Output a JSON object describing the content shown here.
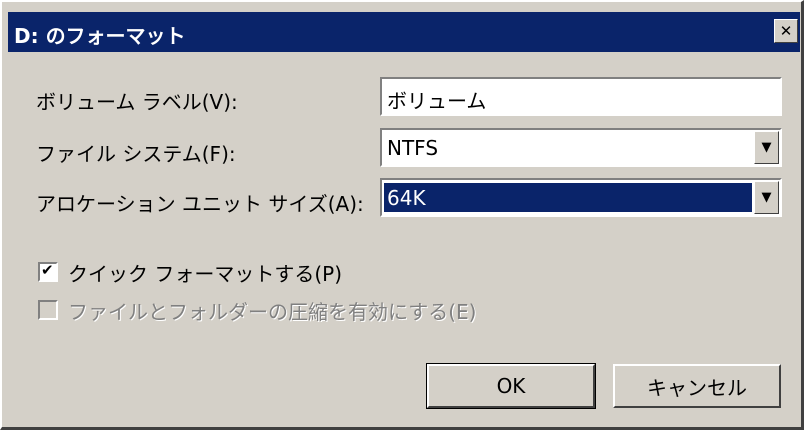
{
  "window": {
    "title": "D: のフォーマット",
    "close_label": "✕"
  },
  "form": {
    "volume_label": {
      "label": "ボリューム ラベル(V):",
      "value": "ボリューム"
    },
    "file_system": {
      "label": "ファイル システム(F):",
      "value": "NTFS"
    },
    "allocation_unit": {
      "label": "アロケーション ユニット サイズ(A):",
      "value": "64K"
    }
  },
  "options": {
    "quick_format": {
      "label": "クイック フォーマットする(P)",
      "checked": true,
      "check_glyph": "✔"
    },
    "compression": {
      "label": "ファイルとフォルダーの圧縮を有効にする(E)",
      "checked": false,
      "enabled": false
    }
  },
  "buttons": {
    "ok": "OK",
    "cancel": "キャンセル"
  },
  "icons": {
    "dropdown": "▼"
  },
  "colors": {
    "titlebar": "#0a246a",
    "face": "#d4d0c8",
    "selection": "#0a246a"
  }
}
